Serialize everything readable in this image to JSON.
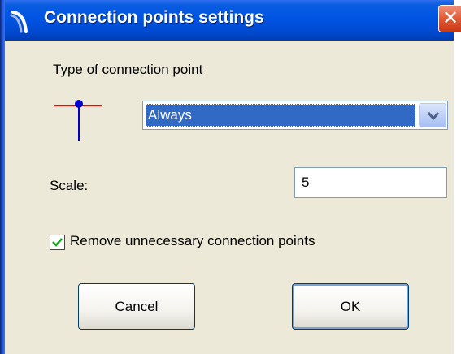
{
  "window": {
    "title": "Connection points settings",
    "close_glyph": "✕"
  },
  "type_label": "Type of connection point",
  "connection_type": {
    "selected": "Always",
    "icon": "connection-point-icon",
    "colors": {
      "horizontal_line": "#ff0000",
      "vertical_line": "#0000cc",
      "dot": "#0000cc"
    }
  },
  "scale": {
    "label": "Scale:",
    "value": "5"
  },
  "remove_option": {
    "label": "Remove unnecessary connection points",
    "checked": true
  },
  "buttons": {
    "cancel": "Cancel",
    "ok": "OK"
  },
  "colors": {
    "titlebar": "#0054e3",
    "dialog_bg": "#ece9d8",
    "selection": "#316ac5"
  }
}
